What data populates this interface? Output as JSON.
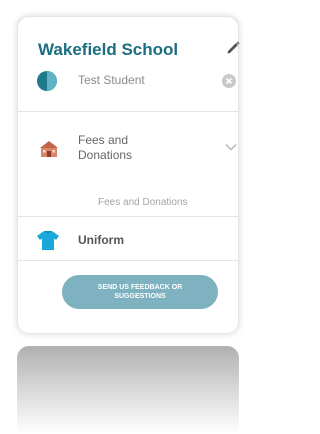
{
  "school": {
    "name": "Wakefield School"
  },
  "student": {
    "name": "Test Student"
  },
  "sections": [
    {
      "title": "Fees and Donations",
      "icon": "school-building-icon",
      "subtitle": "Fees and Donations"
    },
    {
      "title": "Uniform",
      "icon": "tshirt-icon"
    }
  ],
  "feedback_button": {
    "label": "SEND US FEEDBACK OR SUGGESTIONS"
  },
  "colors": {
    "title": "#1b6e80",
    "button": "#7fb2c0",
    "fees_icon": "#c0634a",
    "uniform_icon": "#1aa7d9"
  }
}
